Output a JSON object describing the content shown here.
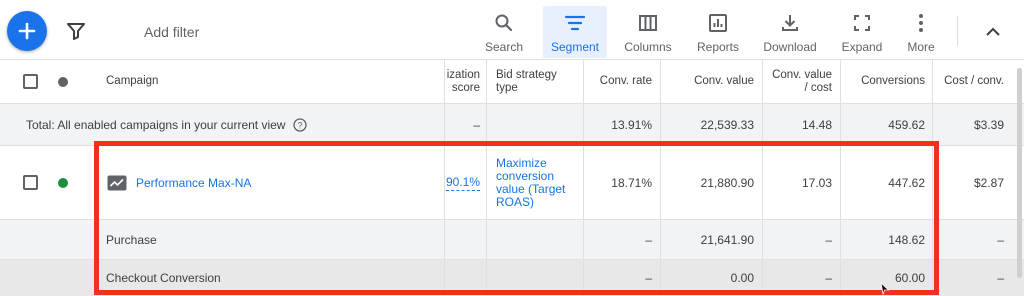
{
  "toolbar": {
    "add_filter": "Add filter",
    "tools": [
      {
        "label": "Search",
        "icon": "search-icon"
      },
      {
        "label": "Segment",
        "icon": "segment-icon",
        "active": true
      },
      {
        "label": "Columns",
        "icon": "columns-icon"
      },
      {
        "label": "Reports",
        "icon": "reports-icon"
      },
      {
        "label": "Download",
        "icon": "download-icon"
      },
      {
        "label": "Expand",
        "icon": "expand-icon"
      },
      {
        "label": "More",
        "icon": "more-vert-icon"
      }
    ]
  },
  "colors": {
    "accent": "#1a73e8",
    "highlight": "#f2301d",
    "status_enabled": "#1e8e3e"
  },
  "table": {
    "headers": {
      "campaign": "Campaign",
      "opt_score": "ization score",
      "bid_strategy": "Bid strategy type",
      "conv_rate": "Conv. rate",
      "conv_value": "Conv. value",
      "conv_value_cost": "Conv. value / cost",
      "conversions": "Conversions",
      "cost_conv": "Cost / conv."
    },
    "total": {
      "label": "Total: All enabled campaigns in your current view",
      "opt_score": "–",
      "conv_rate": "13.91%",
      "conv_value": "22,539.33",
      "conv_value_cost": "14.48",
      "conversions": "459.62",
      "cost_conv": "$3.39"
    },
    "campaign_row": {
      "name": "Performance Max-NA",
      "opt_score": "90.1%",
      "bid_strategy": "Maximize conversion value (Target ROAS)",
      "conv_rate": "18.71%",
      "conv_value": "21,880.90",
      "conv_value_cost": "17.03",
      "conversions": "447.62",
      "cost_conv": "$2.87"
    },
    "segment_rows": [
      {
        "label": "Purchase",
        "conv_rate": "–",
        "conv_value": "21,641.90",
        "conv_value_cost": "–",
        "conversions": "148.62",
        "cost_conv": "–"
      },
      {
        "label": "Checkout Conversion",
        "conv_rate": "–",
        "conv_value": "0.00",
        "conv_value_cost": "–",
        "conversions": "60.00",
        "cost_conv": "–"
      }
    ]
  }
}
